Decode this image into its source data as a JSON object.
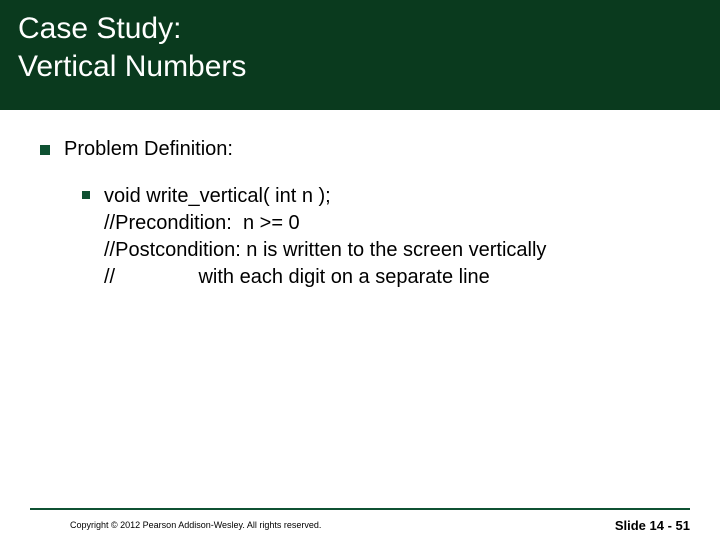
{
  "title_line1": "Case Study:",
  "title_line2": "Vertical Numbers",
  "bullet1": "Problem Definition:",
  "code_block": "void write_vertical( int n );\n//Precondition:  n >= 0\n//Postcondition: n is written to the screen vertically\n//               with each digit on a separate line",
  "copyright": "Copyright © 2012 Pearson Addison-Wesley.  All rights reserved.",
  "slide_number": "Slide 14 - 51"
}
